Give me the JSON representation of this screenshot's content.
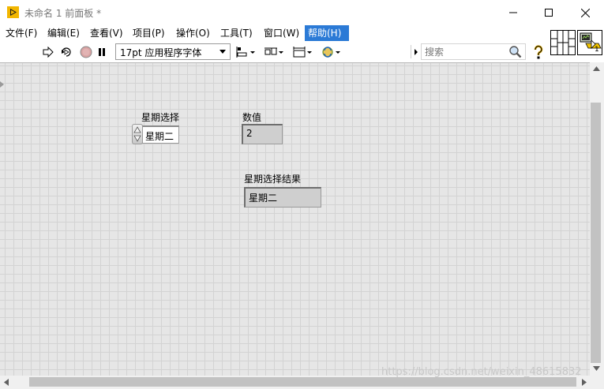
{
  "window": {
    "title": "未命名 1 前面板 *",
    "accent": "#2b7ad6"
  },
  "menu": {
    "items": [
      {
        "label": "文件(F)"
      },
      {
        "label": "编辑(E)"
      },
      {
        "label": "查看(V)"
      },
      {
        "label": "项目(P)"
      },
      {
        "label": "操作(O)"
      },
      {
        "label": "工具(T)"
      },
      {
        "label": "窗口(W)"
      },
      {
        "label": "帮助(H)",
        "active": true
      }
    ]
  },
  "toolbar": {
    "font_setting": "17pt 应用程序字体",
    "search_placeholder": "搜索",
    "icons": [
      "run-arrow-icon",
      "run-continuously-icon",
      "abort-icon",
      "pause-icon",
      "align-icon",
      "distribute-icon",
      "resize-icon",
      "reorder-icon",
      "search-icon",
      "help-icon"
    ]
  },
  "vi_icon": {
    "number": "1"
  },
  "panel": {
    "weekday_ring": {
      "label": "星期选择",
      "value": "星期二"
    },
    "numeric": {
      "label": "数值",
      "value": "2"
    },
    "result": {
      "label": "星期选择结果",
      "value": "星期二"
    }
  },
  "watermark": "https://blog.csdn.net/weixin_48615832"
}
